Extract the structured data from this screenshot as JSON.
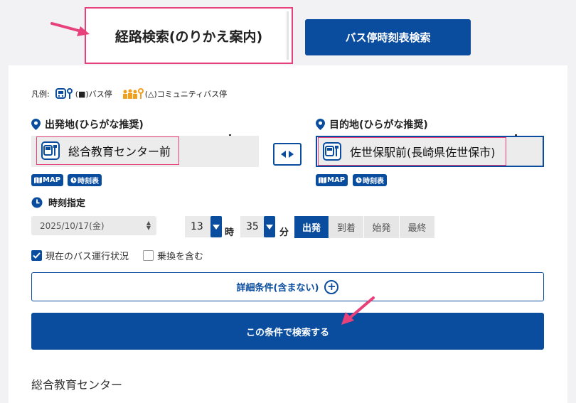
{
  "tabs": {
    "route_search": "経路検索(のりかえ案内)",
    "timetable_search": "バス停時刻表検索"
  },
  "legend": {
    "label": "凡例:",
    "bus_stop": "(■)バス停",
    "community_bus_stop": "(△)コミュニティバス停"
  },
  "origin": {
    "label": "出発地(ひらがな推奨)",
    "value": "総合教育センター前",
    "map_label": "MAP",
    "timetable_label": "時刻表"
  },
  "destination": {
    "label": "目的地(ひらがな推奨)",
    "value": "佐世保駅前(長崎県佐世保市)",
    "map_label": "MAP",
    "timetable_label": "時刻表"
  },
  "time": {
    "label": "時刻指定",
    "date": "2025/10/17(金)",
    "hour": "13",
    "hour_unit": "時",
    "minute": "35",
    "minute_unit": "分",
    "modes": [
      "出発",
      "到着",
      "始発",
      "最終"
    ],
    "selected_mode": "出発"
  },
  "options": {
    "bus_status": "現在のバス運行状況",
    "bus_status_checked": true,
    "include_transfer": "乗換を含む",
    "include_transfer_checked": false
  },
  "buttons": {
    "detail": "詳細条件(含まない)",
    "search": "この条件で検索する"
  },
  "history": {
    "item": "総合教育センター"
  },
  "colors": {
    "primary": "#0a4d9e",
    "annotation": "#e8407a",
    "community": "#f0a020"
  }
}
